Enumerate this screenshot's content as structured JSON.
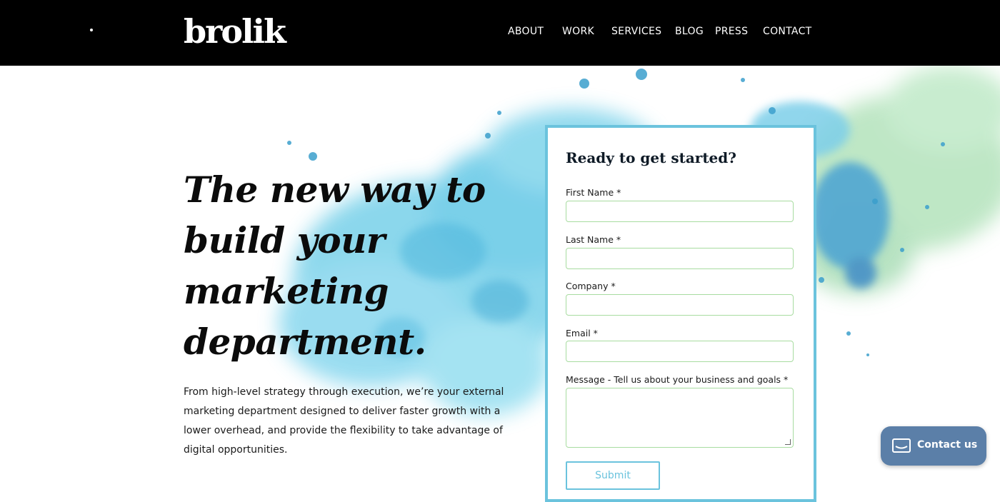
{
  "header": {
    "logo_text": "brolik",
    "nav": [
      {
        "label": "ABOUT"
      },
      {
        "label": "WORK"
      },
      {
        "label": "SERVICES"
      },
      {
        "label": "BLOG"
      },
      {
        "label": "PRESS"
      },
      {
        "label": "CONTACT"
      }
    ]
  },
  "hero": {
    "title_lines": [
      "The new way to",
      "build your",
      "marketing",
      "department."
    ],
    "description": "From high-level strategy through execution, we’re your external marketing department designed to deliver faster growth with a lower overhead, and provide the flexibility to take advantage of digital opportunities."
  },
  "form": {
    "title": "Ready to get started?",
    "fields": [
      {
        "label": "First Name *",
        "value": ""
      },
      {
        "label": "Last Name *",
        "value": ""
      },
      {
        "label": "Company *",
        "value": ""
      },
      {
        "label": "Email *",
        "value": ""
      },
      {
        "label": "Message - Tell us about your business and goals *",
        "value": ""
      }
    ],
    "submit_label": "Submit"
  },
  "contact_widget": {
    "label": "Contact us",
    "icon": "envelope-icon"
  },
  "colors": {
    "header_bg": "#000000",
    "card_border": "#6bc3dd",
    "input_border": "#a8dca0",
    "splash_blue": "#5ec8e6",
    "splash_green": "#a6dcb0",
    "contact_bg": "#5b7fa8"
  }
}
